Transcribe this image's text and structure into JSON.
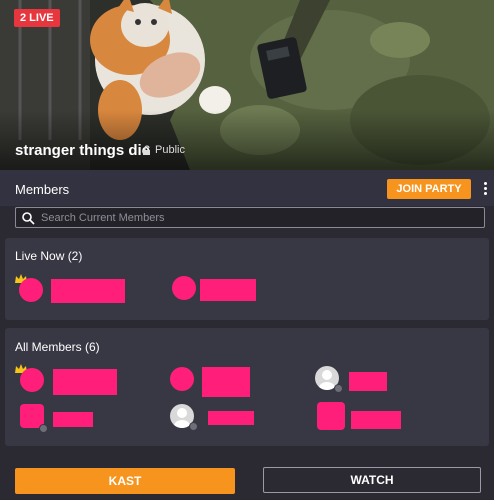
{
  "hero": {
    "live_badge": "2 LIVE",
    "room_title": "stranger things die",
    "privacy_label": "Public"
  },
  "members": {
    "label": "Members",
    "join_button": "JOIN PARTY",
    "search_placeholder": "Search Current Members"
  },
  "live_now": {
    "title": "Live Now (2)"
  },
  "all_members": {
    "title": "All Members (6)"
  },
  "footer": {
    "kast_button": "KAST",
    "watch_button": "WATCH"
  },
  "colors": {
    "accent_orange": "#f7941e",
    "live_red": "#e8363f",
    "redaction_pink": "#ff1f7a",
    "background": "#2b2a33",
    "panel": "#383744"
  }
}
